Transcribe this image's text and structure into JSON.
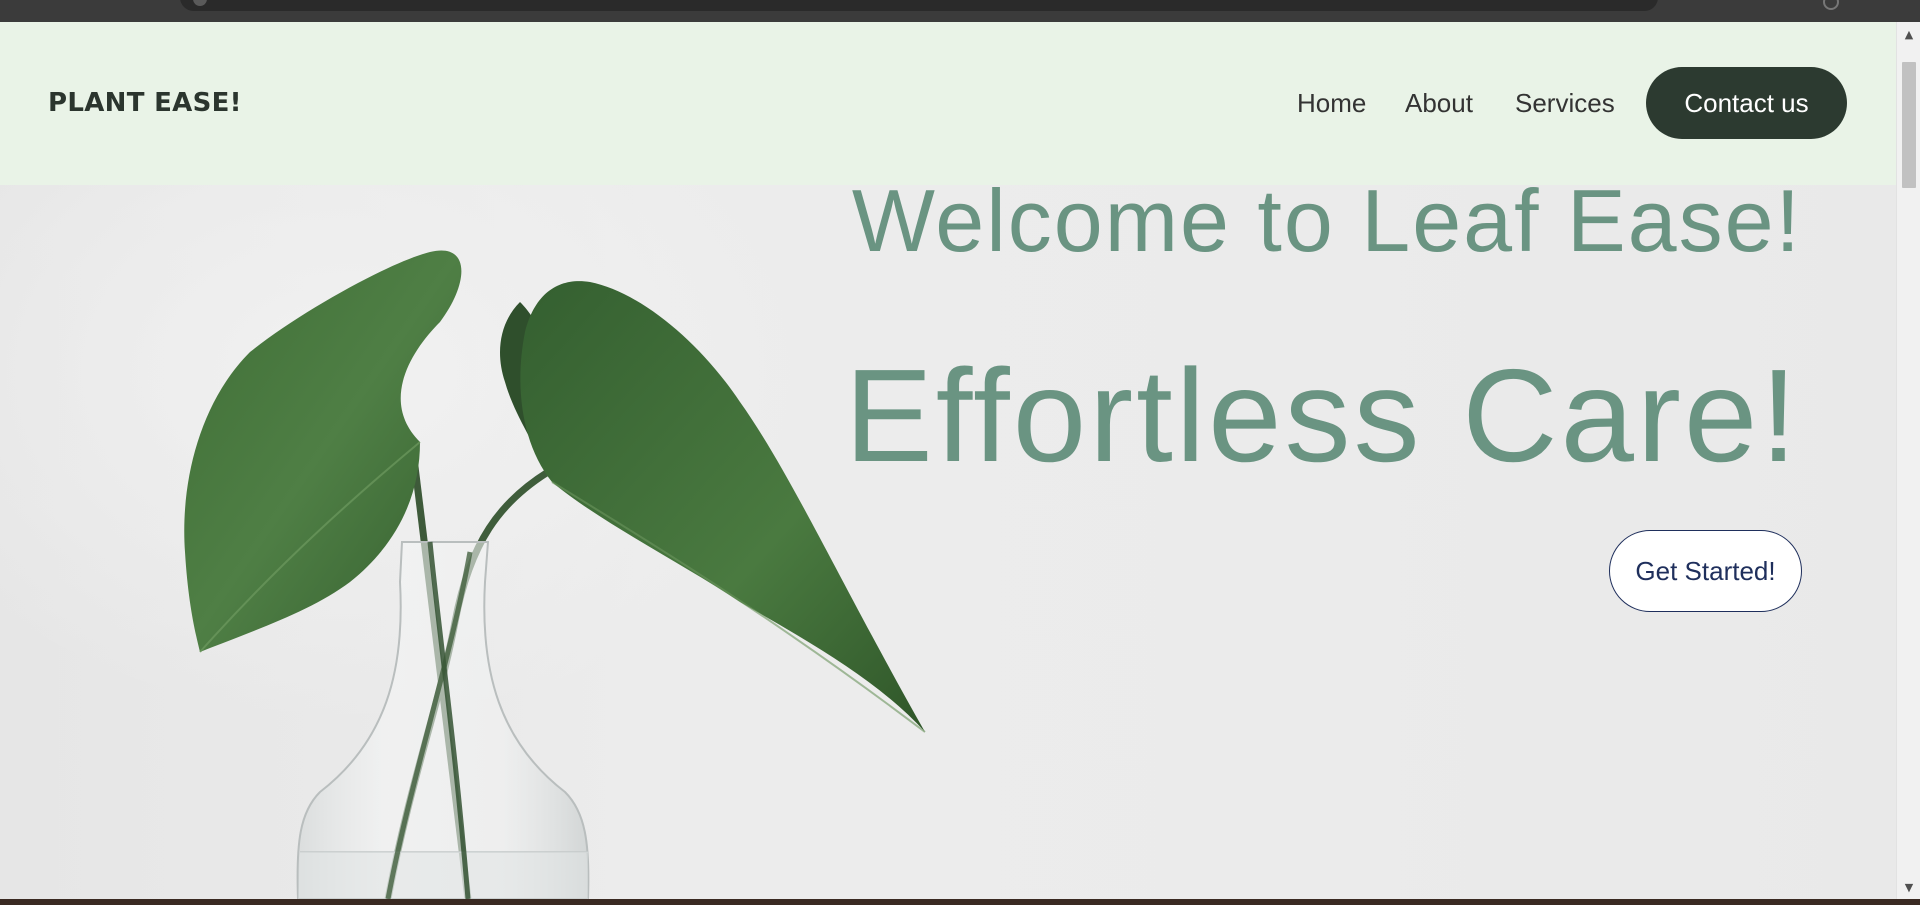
{
  "nav": {
    "brand": "PLANT EASE!",
    "links": [
      "Home",
      "About",
      "Services"
    ],
    "contact_label": "Contact us"
  },
  "hero": {
    "title": "Welcome to Leaf Ease!",
    "subtitle": "Effortless Care!",
    "cta_label": "Get Started!"
  },
  "scrollbar": {
    "up_icon": "▲",
    "down_icon": "▼"
  },
  "colors": {
    "nav_bg": "#e9f3e7",
    "accent_green": "#6a9482",
    "dark_button": "#2c3a30",
    "cta_border": "#1f2f5c"
  }
}
